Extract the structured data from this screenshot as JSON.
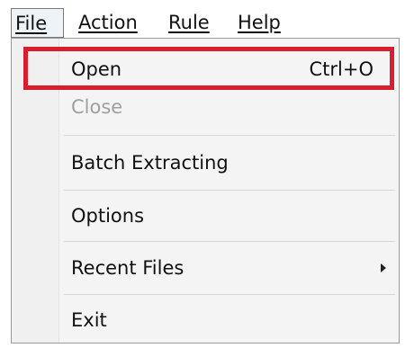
{
  "menubar": {
    "file": "File",
    "action": "Action",
    "rule": "Rule",
    "help": "Help"
  },
  "menu": {
    "items": [
      {
        "label": "Open",
        "shortcut": "Ctrl+O"
      },
      {
        "label": "Close"
      },
      {
        "label": "Batch Extracting"
      },
      {
        "label": "Options"
      },
      {
        "label": "Recent Files"
      },
      {
        "label": "Exit"
      }
    ]
  },
  "colors": {
    "highlight": "#d81f2f",
    "disabled_text": "#9f9f9f"
  },
  "icons": {
    "submenu": "submenu-arrow-icon"
  }
}
